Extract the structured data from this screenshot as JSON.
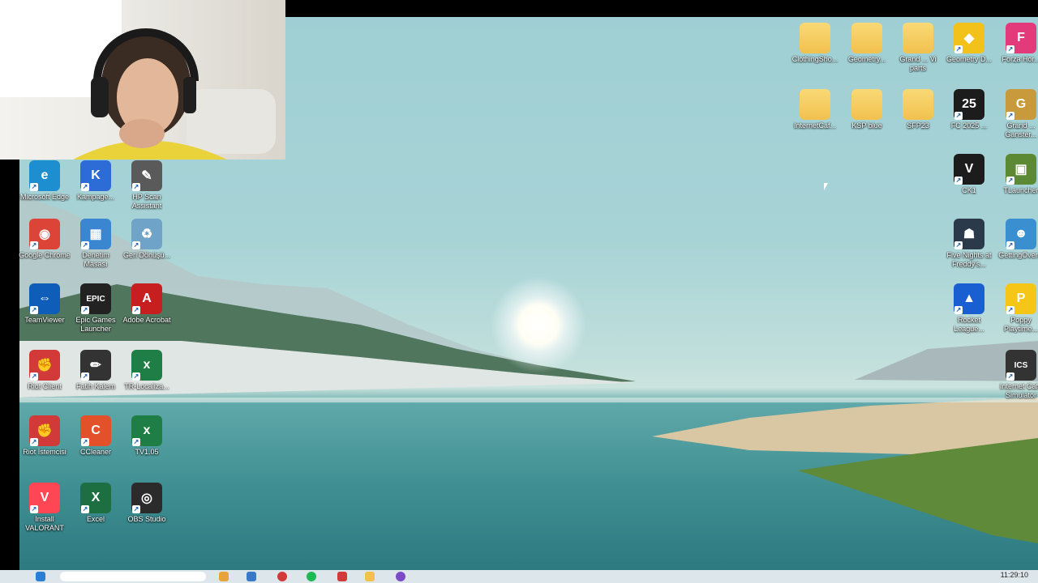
{
  "desktop": {
    "left_icons": [
      {
        "name": "edge-icon",
        "label": "Microsoft Edge",
        "color": "#1d8fd1",
        "glyph": "e"
      },
      {
        "name": "campaign-icon",
        "label": "Kampage...",
        "color": "#2d6bd6",
        "glyph": "K"
      },
      {
        "name": "hp-scan-icon",
        "label": "HP Scan Assistant",
        "color": "#5a5a5a",
        "glyph": "✎"
      },
      {
        "name": "chrome-icon",
        "label": "Google Chrome",
        "color": "#db4437",
        "glyph": "◉"
      },
      {
        "name": "control-panel-icon",
        "label": "Denetim Masası",
        "color": "#3a86d0",
        "glyph": "▦"
      },
      {
        "name": "recycle-bin-icon",
        "label": "Geri Dönüşü...",
        "color": "#6fa3c7",
        "glyph": "♻"
      },
      {
        "name": "teamviewer-icon",
        "label": "TeamViewer",
        "color": "#0e5db8",
        "glyph": "⇔"
      },
      {
        "name": "epic-games-icon",
        "label": "Epic Games Launcher",
        "color": "#222222",
        "glyph": "EPIC"
      },
      {
        "name": "adobe-acrobat-icon",
        "label": "Adobe Acrobat",
        "color": "#c71f1f",
        "glyph": "A"
      },
      {
        "name": "riot-client-icon",
        "label": "Riot Client",
        "color": "#d23a3a",
        "glyph": "✊"
      },
      {
        "name": "fatih-kalem-icon",
        "label": "Fatih Kalem",
        "color": "#333333",
        "glyph": "✏"
      },
      {
        "name": "tr-localization-icon",
        "label": "TR-Localiza...",
        "color": "#1e7e45",
        "glyph": "x"
      },
      {
        "name": "riot-istemcisi-icon",
        "label": "Riot İstemcisi",
        "color": "#d23a3a",
        "glyph": "✊"
      },
      {
        "name": "ccleaner-icon",
        "label": "CCleaner",
        "color": "#e3512a",
        "glyph": "C"
      },
      {
        "name": "tv105-icon",
        "label": "TV1.05",
        "color": "#1e7e45",
        "glyph": "x"
      },
      {
        "name": "valorant-icon",
        "label": "Install VALORANT",
        "color": "#ff4655",
        "glyph": "V"
      },
      {
        "name": "excel-icon",
        "label": "Excel",
        "color": "#1d6f42",
        "glyph": "X"
      },
      {
        "name": "obs-studio-icon",
        "label": "OBS Studio",
        "color": "#2b2b2b",
        "glyph": "◎"
      }
    ],
    "right_icons": [
      {
        "name": "folder-icon",
        "label": "ClothingSho...",
        "type": "folder"
      },
      {
        "name": "folder-icon",
        "label": "Geometry...",
        "type": "folder"
      },
      {
        "name": "folder-icon",
        "label": "Grand ... Vi parts",
        "type": "folder"
      },
      {
        "name": "geometry-dash-icon",
        "label": "Geometry D...",
        "color": "#f2c21a",
        "glyph": "◆"
      },
      {
        "name": "forza-icon",
        "label": "Forza Hor...",
        "color": "#e23a7a",
        "glyph": "F"
      },
      {
        "name": "folder-icon",
        "label": "InternetCaf...",
        "type": "folder"
      },
      {
        "name": "folder-icon",
        "label": "KSP blue",
        "type": "folder"
      },
      {
        "name": "folder-icon",
        "label": "SFP23",
        "type": "folder"
      },
      {
        "name": "fc25-icon",
        "label": "FC 2025 ...",
        "color": "#1c1c1c",
        "glyph": "25"
      },
      {
        "name": "gta-icon",
        "label": "Grand ... Ganster...",
        "color": "#c89a3b",
        "glyph": "G"
      },
      {
        "name": "valorant2-icon",
        "label": "CK1",
        "color": "#1c1c1c",
        "glyph": "V"
      },
      {
        "name": "minecraft-icon",
        "label": "TLauncher",
        "color": "#5c8a34",
        "glyph": "▣"
      },
      {
        "name": "five-nights-icon",
        "label": "Five Nights at Freddy's...",
        "color": "#2b3a4a",
        "glyph": "☗"
      },
      {
        "name": "getting-over-icon",
        "label": "GettingOver...",
        "color": "#3a8fd0",
        "glyph": "☻"
      },
      {
        "name": "rocket-league-icon",
        "label": "Rocket League...",
        "color": "#1a5fd1",
        "glyph": "▲"
      },
      {
        "name": "poppy-playtime-icon",
        "label": "Poppy Playtime...",
        "color": "#f5c518",
        "glyph": "P"
      },
      {
        "name": "internet-cafe-icon",
        "label": "Internet Cafe Simulator",
        "color": "#333333",
        "glyph": "ICS"
      }
    ]
  },
  "taskbar": {
    "clock": "11:29:10"
  }
}
